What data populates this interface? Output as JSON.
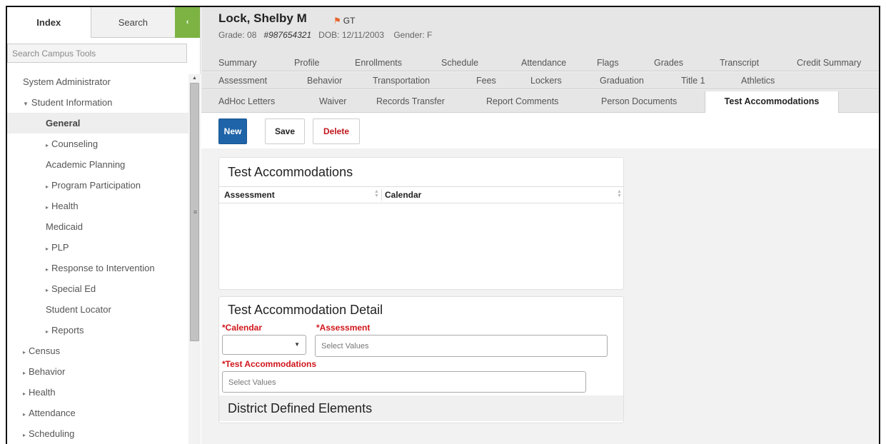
{
  "sidebar": {
    "tab_index": "Index",
    "tab_search": "Search",
    "collapse_icon": "‹",
    "search_placeholder": "Search Campus Tools",
    "items": [
      {
        "label": "System Administrator"
      },
      {
        "label": "Student Information",
        "toggle": "▼"
      },
      {
        "label": "General"
      },
      {
        "label": "Counseling",
        "toggle": "▸"
      },
      {
        "label": "Academic Planning"
      },
      {
        "label": "Program Participation",
        "toggle": "▸"
      },
      {
        "label": "Health",
        "toggle": "▸"
      },
      {
        "label": "Medicaid"
      },
      {
        "label": "PLP",
        "toggle": "▸"
      },
      {
        "label": "Response to Intervention",
        "toggle": "▸"
      },
      {
        "label": "Special Ed",
        "toggle": "▸"
      },
      {
        "label": "Student Locator"
      },
      {
        "label": "Reports",
        "toggle": "▸"
      },
      {
        "label": "Census",
        "toggle": "▸"
      },
      {
        "label": "Behavior",
        "toggle": "▸"
      },
      {
        "label": "Health",
        "toggle": "▸"
      },
      {
        "label": "Attendance",
        "toggle": "▸"
      },
      {
        "label": "Scheduling",
        "toggle": "▸"
      }
    ]
  },
  "student": {
    "name": "Lock, Shelby M",
    "flag": "GT",
    "grade": "Grade: 08",
    "id": "#987654321",
    "dob": "DOB: 12/11/2003",
    "gender": "Gender: F"
  },
  "tabs": {
    "row1": [
      "Summary",
      "Profile",
      "Enrollments",
      "Schedule",
      "Attendance",
      "Flags",
      "Grades",
      "Transcript",
      "Credit Summary"
    ],
    "row2": [
      "Assessment",
      "Behavior",
      "Transportation",
      "Fees",
      "Lockers",
      "Graduation",
      "Title 1",
      "Athletics"
    ],
    "row3": [
      "AdHoc Letters",
      "Waiver",
      "Records Transfer",
      "Report Comments",
      "Person Documents",
      "Test Accommodations"
    ]
  },
  "toolbar": {
    "new_label": "New",
    "save_label": "Save",
    "delete_label": "Delete"
  },
  "list_panel": {
    "title": "Test Accommodations",
    "columns": [
      "Assessment",
      "Calendar"
    ]
  },
  "detail_panel": {
    "title": "Test Accommodation Detail",
    "calendar_label": "*Calendar",
    "calendar_value": "",
    "assessment_label": "*Assessment",
    "assessment_placeholder": "Select Values",
    "accommodations_label": "*Test Accommodations",
    "accommodations_placeholder": "Select Values",
    "district_title": "District Defined Elements"
  },
  "colors": {
    "accent_green": "#7cb342",
    "primary_blue": "#1f64a8",
    "required_red": "#d0161b",
    "flag_orange": "#e8632b"
  }
}
